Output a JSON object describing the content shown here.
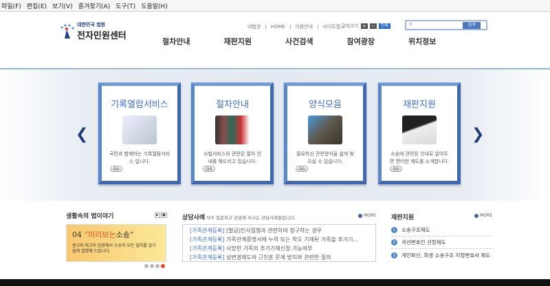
{
  "menubar": [
    "파일(F)",
    "편집(E)",
    "보기(V)",
    "즐겨찾기(A)",
    "도구(T)",
    "도움말(H)"
  ],
  "logo": {
    "sub": "대한민국 법원",
    "main": "전자민원센터"
  },
  "util_links": [
    "대법원",
    "HOME",
    "이용안내",
    "사이트맵"
  ],
  "font_size": {
    "label": "글자크기",
    "plus": "+",
    "minus": "−",
    "print": "인쇄"
  },
  "search": {
    "button": "검색",
    "placeholder": ""
  },
  "nav": [
    "절차안내",
    "재판지원",
    "사건검색",
    "참여광장",
    "위치정보"
  ],
  "cards": [
    {
      "title": "기록열람서비스",
      "desc": "국민과 함께하는 기록열람서비스 입니다.",
      "go": "Go",
      "color": "#b9c7cf"
    },
    {
      "title": "절차안내",
      "desc": "사법서비스와 관련된 절차 안내를 해드리고 있습니다.",
      "go": "Go",
      "color": "#8a4d4d"
    },
    {
      "title": "양식모음",
      "desc": "필요하신 관련양식을 쉽게 찾으실 수 있습니다.",
      "go": "Go",
      "color": "#5e5648"
    },
    {
      "title": "재판지원",
      "desc": "소송에 관련된 안내로 알아두면 편리한 제도를 소개합니다.",
      "go": "Go",
      "color": "#d9d9d9"
    }
  ],
  "arrows": {
    "prev": "❮",
    "next": "❯"
  },
  "story": {
    "title": "생활속의 법이야기",
    "num": "04",
    "headline_em": "“미리보는",
    "headline_rest": "소송”",
    "desc": "원고와 피고의 입장에서 소송의 모든 절차를 알기 쉽게 설명해 드립니다.",
    "play": "▶",
    "stop": "■",
    "active_dot": 4
  },
  "cases": {
    "title": "상담사례",
    "subtitle": "자주 질문하고 궁금해 하시는 상담사례들입니다.",
    "more": "MORE",
    "items": [
      {
        "cat": "[가족관계등록]",
        "text": "[발급]인사집행과 관련하여 청구하는 경우"
      },
      {
        "cat": "[가족관계등록]",
        "text": "가족관계증명서에 누락 또는 착오 기재된 가족을 추가기..."
      },
      {
        "cat": "[가족관계등록]",
        "text": "사망한 가족의 추가기재신청 가능여부"
      },
      {
        "cat": "[가족관계등록]",
        "text": "성변경제도와 근친혼 문제 방지와 관련한 질의"
      }
    ]
  },
  "support": {
    "title": "재판지원",
    "more": "MORE",
    "items": [
      {
        "num": "1",
        "text": "소송구조제도"
      },
      {
        "num": "2",
        "text": "국선변호인 선정제도"
      },
      {
        "num": "3",
        "text": "개인파산, 회생 소송구조 지정변호사 제도"
      }
    ]
  }
}
